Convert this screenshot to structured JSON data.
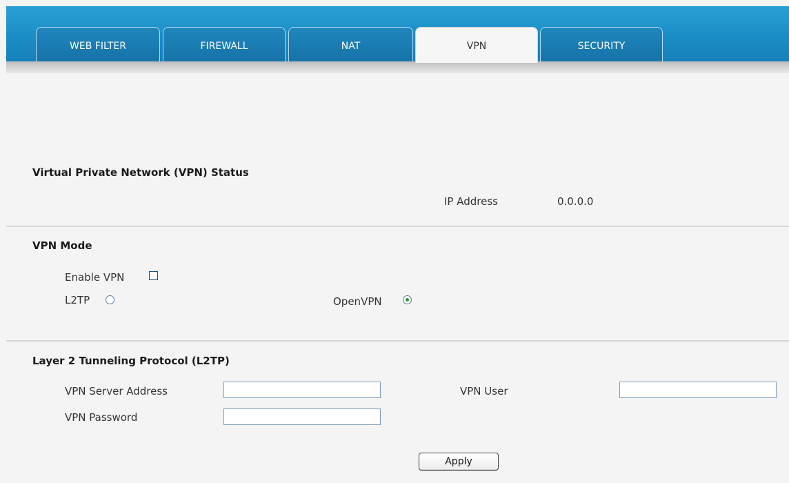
{
  "tabs": [
    {
      "label": "WEB FILTER",
      "active": false
    },
    {
      "label": "FIREWALL",
      "active": false
    },
    {
      "label": "NAT",
      "active": false
    },
    {
      "label": "VPN",
      "active": true
    },
    {
      "label": "SECURITY",
      "active": false
    }
  ],
  "status": {
    "title": "Virtual Private Network (VPN) Status",
    "ip_label": "IP Address",
    "ip_value": "0.0.0.0"
  },
  "mode": {
    "title": "VPN Mode",
    "enable_label": "Enable VPN",
    "enable_checked": false,
    "l2tp_label": "L2TP",
    "l2tp_selected": false,
    "openvpn_label": "OpenVPN",
    "openvpn_selected": true
  },
  "l2tp": {
    "title": "Layer 2 Tunneling Protocol (L2TP)",
    "server_label": "VPN Server Address",
    "server_value": "",
    "user_label": "VPN User",
    "user_value": "",
    "password_label": "VPN Password",
    "password_value": ""
  },
  "apply_label": "Apply",
  "colors": {
    "header_blue": "#1b8dc6",
    "active_tab": "#f6f6f6",
    "radio_dot": "#2e9a2e"
  }
}
